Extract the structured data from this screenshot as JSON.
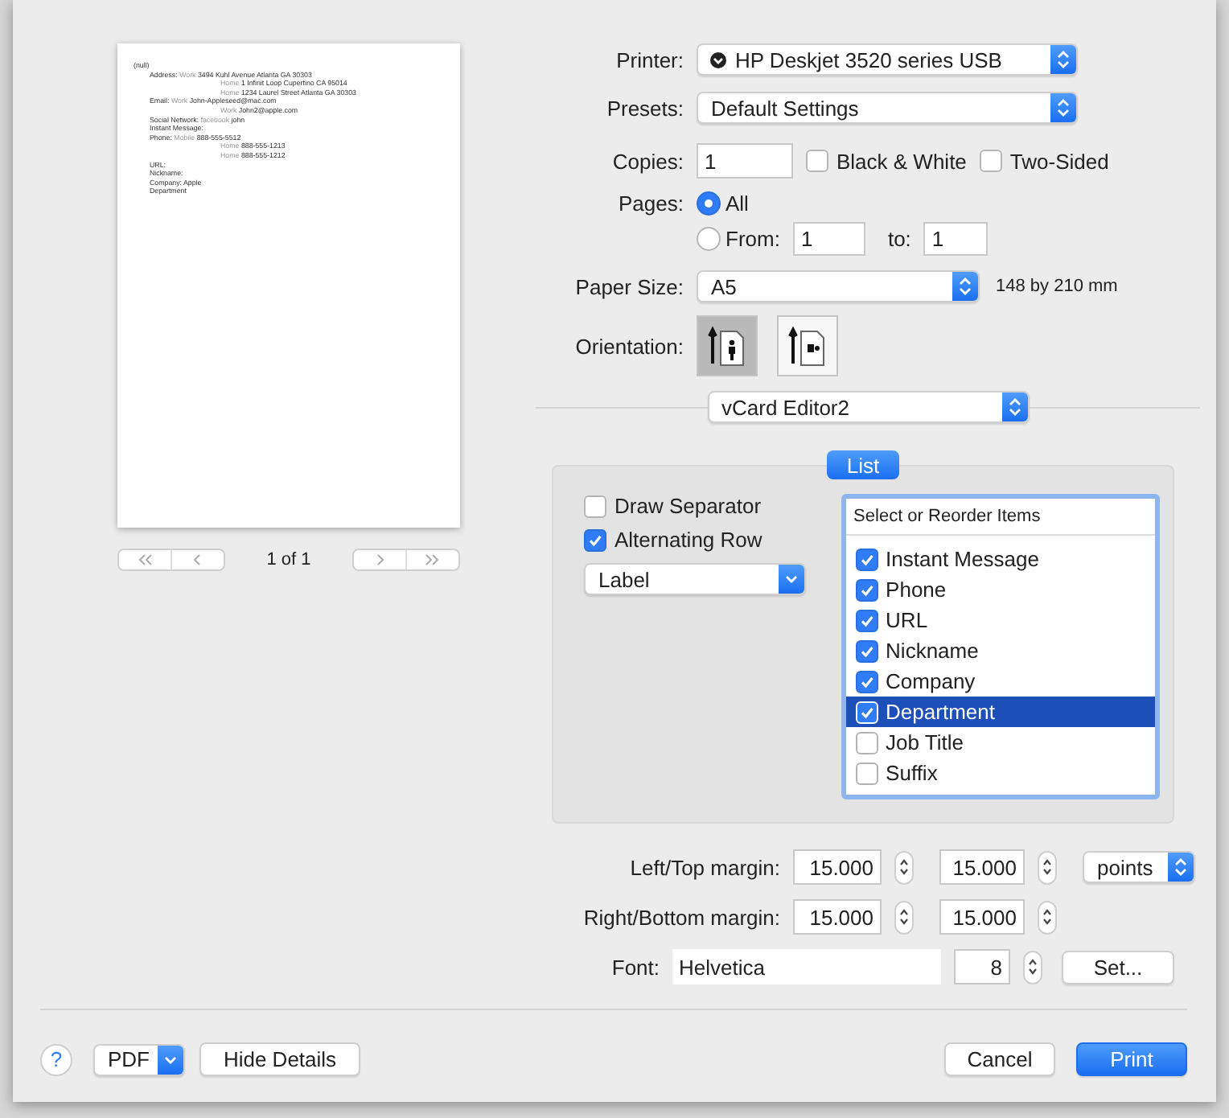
{
  "preview": {
    "lines": [
      {
        "kind": "title",
        "text": "(null)"
      },
      {
        "kind": "field",
        "label": "Address:",
        "type": "Work",
        "value": "3494 Kuhl Avenue Atlanta GA 30303"
      },
      {
        "kind": "continuation",
        "type": "Home",
        "value": "1 Infinit Loop Cupertino CA 95014"
      },
      {
        "kind": "continuation",
        "type": "Home",
        "value": "1234 Laurel Street Atlanta GA 30303"
      },
      {
        "kind": "field",
        "label": "Email:",
        "type": "Work",
        "value": "John-Appleseed@mac.com"
      },
      {
        "kind": "continuation",
        "type": "Work",
        "value": "John2@apple.com"
      },
      {
        "kind": "field",
        "label": "Social Network:",
        "type": "facebook",
        "value": "john"
      },
      {
        "kind": "field",
        "label": "Instant Message:"
      },
      {
        "kind": "field",
        "label": "Phone:",
        "type": "Mobile",
        "value": "888-555-5512"
      },
      {
        "kind": "continuation",
        "type": "Home",
        "value": "888-555-1213"
      },
      {
        "kind": "continuation",
        "type": "Home",
        "value": "888-555-1212"
      },
      {
        "kind": "field",
        "label": "URL:"
      },
      {
        "kind": "field",
        "label": "Nickname:"
      },
      {
        "kind": "field",
        "label": "Company:",
        "value": "Apple"
      },
      {
        "kind": "field",
        "label": "Department"
      }
    ],
    "page_indicator": "1 of 1"
  },
  "printer": {
    "label": "Printer:",
    "value": "HP Deskjet 3520 series USB"
  },
  "presets": {
    "label": "Presets:",
    "value": "Default Settings"
  },
  "copies": {
    "label": "Copies:",
    "value": "1"
  },
  "print_options": [
    {
      "label": "Black & White",
      "checked": false
    },
    {
      "label": "Two-Sided",
      "checked": false
    }
  ],
  "pages": {
    "label": "Pages:",
    "choices": [
      {
        "label": "All",
        "selected": true
      },
      {
        "label": "From:",
        "selected": false
      }
    ],
    "from": "1",
    "to_label": "to:",
    "to": "1"
  },
  "paper_size": {
    "label": "Paper Size:",
    "value": "A5",
    "dimensions": "148 by 210 mm"
  },
  "orientation": {
    "label": "Orientation:",
    "choices": [
      {
        "kind": "portrait",
        "selected": true
      },
      {
        "kind": "landscape",
        "selected": false
      }
    ]
  },
  "panel_menu": {
    "value": "vCard Editor2"
  },
  "panel_tab": {
    "label": "List",
    "selected": true
  },
  "panel_options": [
    {
      "label": "Draw Separator",
      "checked": false
    },
    {
      "label": "Alternating Row",
      "checked": true
    }
  ],
  "label_style": {
    "value": "Label"
  },
  "item_list": {
    "header": "Select or Reorder Items",
    "items": [
      {
        "label": "Instant Message",
        "checked": true,
        "selected": false
      },
      {
        "label": "Phone",
        "checked": true,
        "selected": false
      },
      {
        "label": "URL",
        "checked": true,
        "selected": false
      },
      {
        "label": "Nickname",
        "checked": true,
        "selected": false
      },
      {
        "label": "Company",
        "checked": true,
        "selected": false
      },
      {
        "label": "Department",
        "checked": true,
        "selected": true
      },
      {
        "label": "Job Title",
        "checked": false,
        "selected": false
      },
      {
        "label": "Suffix",
        "checked": false,
        "selected": false
      }
    ]
  },
  "margins": [
    {
      "label": "Left/Top margin:",
      "values": [
        "15.000",
        "15.000"
      ]
    },
    {
      "label": "Right/Bottom margin:",
      "values": [
        "15.000",
        "15.000"
      ]
    }
  ],
  "units": {
    "value": "points"
  },
  "font": {
    "label": "Font:",
    "name": "Helvetica",
    "size": "8",
    "button": "Set..."
  },
  "buttons": {
    "help": "?",
    "pdf": "PDF",
    "hide_details": "Hide Details",
    "cancel": "Cancel",
    "print": "Print"
  }
}
